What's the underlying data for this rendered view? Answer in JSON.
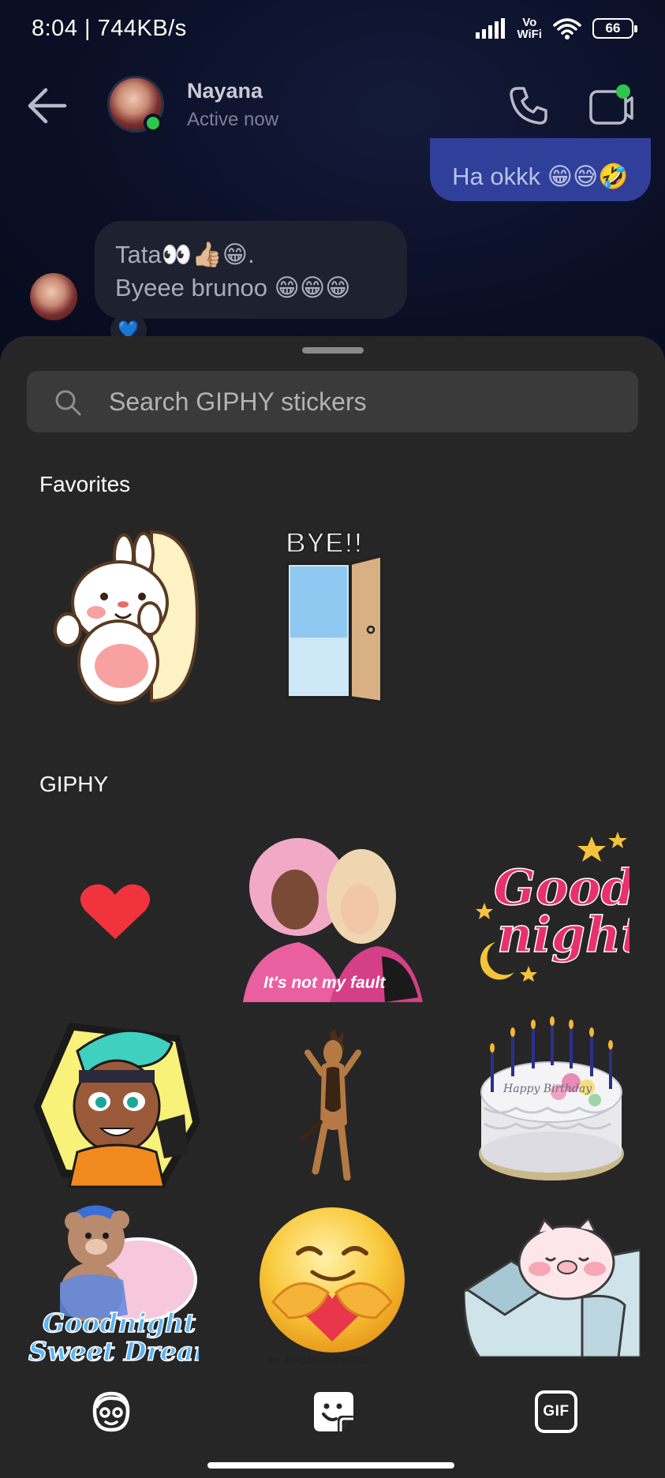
{
  "status_bar": {
    "time": "8:04 | 744KB/s",
    "vo_wifi_top": "Vo",
    "vo_wifi_bottom": "WiFi",
    "battery": "66"
  },
  "header": {
    "contact_name": "Nayana",
    "contact_status": "Active now"
  },
  "messages": {
    "outgoing": "Ha okkk 😁😅🤣",
    "incoming_line1": "Tata👀👍🏼😁.",
    "incoming_line2": "Byeee brunoo 😁😁😁",
    "reaction": "💙"
  },
  "sticker_sheet": {
    "search_placeholder": "Search GIPHY stickers",
    "favorites_title": "Favorites",
    "giphy_title": "GIPHY",
    "favorites": [
      {
        "icon": "bunny-peek-sticker"
      },
      {
        "icon": "bye-door-sticker",
        "text": "BYE!!"
      }
    ],
    "giphy": [
      {
        "icon": "red-heart-sticker"
      },
      {
        "icon": "its-not-my-fault-sticker",
        "text": "It's not my fault"
      },
      {
        "icon": "good-night-sticker",
        "text_line1": "Good",
        "text_line2": "night"
      },
      {
        "icon": "cartoon-girl-sticker"
      },
      {
        "icon": "dancing-dog-sticker"
      },
      {
        "icon": "birthday-cake-sticker",
        "text": "Happy Birthday"
      },
      {
        "icon": "teddy-bear-sticker",
        "text_line1": "Goodnight",
        "text_line2": "Sweet Dreams"
      },
      {
        "icon": "hugging-face-sticker",
        "text": "BY @FUJIKONPHOTO"
      },
      {
        "icon": "sleepy-pig-sticker"
      }
    ]
  },
  "bottom_nav": {
    "items": [
      {
        "icon": "avatar-icon"
      },
      {
        "icon": "sticker-icon"
      },
      {
        "icon": "gif-icon",
        "label": "GIF"
      }
    ]
  },
  "colors": {
    "chat_bg": "#0b1024",
    "outgoing_bubble": "#2f3f9a",
    "incoming_bubble": "#1d2130",
    "sheet_bg": "#262626",
    "search_bg": "#3a3a3a",
    "online": "#2ec74a"
  }
}
